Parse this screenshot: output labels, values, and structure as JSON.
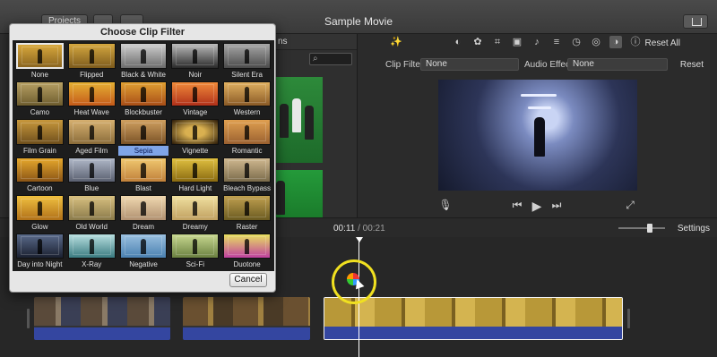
{
  "window": {
    "title": "Sample Movie",
    "projects_button": "Projects"
  },
  "browser": {
    "tab_fragment": "ns",
    "search_placeholder": ""
  },
  "viewer": {
    "reset_all": "Reset All",
    "clip_filter_label": "Clip Filter:",
    "clip_filter_value": "None",
    "audio_effect_label": "Audio Effect:",
    "audio_effect_value": "None",
    "reset": "Reset",
    "tool_icons": [
      "magic-wand-icon",
      "color-balance-icon",
      "palette-icon",
      "crop-icon",
      "camera-icon",
      "volume-icon",
      "equalizer-icon",
      "speed-icon",
      "stabilization-icon",
      "clip-filter-icon",
      "info-icon"
    ],
    "active_tool": "clip-filter-icon"
  },
  "playback": {
    "current_time": "00:11",
    "separator": "/",
    "total_time": "00:21",
    "settings": "Settings"
  },
  "dialog": {
    "title": "Choose Clip Filter",
    "cancel": "Cancel",
    "selected": "Sepia",
    "filters": [
      {
        "name": "None",
        "style": "f-none"
      },
      {
        "name": "Flipped",
        "style": "f-flipped"
      },
      {
        "name": "Black & White",
        "style": "f-bw"
      },
      {
        "name": "Noir",
        "style": "f-noir"
      },
      {
        "name": "Silent Era",
        "style": "f-silent"
      },
      {
        "name": "Camo",
        "style": "f-camo"
      },
      {
        "name": "Heat Wave",
        "style": "f-heat"
      },
      {
        "name": "Blockbuster",
        "style": "f-block"
      },
      {
        "name": "Vintage",
        "style": "f-vintage"
      },
      {
        "name": "Western",
        "style": "f-western"
      },
      {
        "name": "Film Grain",
        "style": "f-grain"
      },
      {
        "name": "Aged Film",
        "style": "f-aged"
      },
      {
        "name": "Sepia",
        "style": "f-sepia"
      },
      {
        "name": "Vignette",
        "style": "f-vignette"
      },
      {
        "name": "Romantic",
        "style": "f-romantic"
      },
      {
        "name": "Cartoon",
        "style": "f-cartoon"
      },
      {
        "name": "Blue",
        "style": "f-blue"
      },
      {
        "name": "Blast",
        "style": "f-blast"
      },
      {
        "name": "Hard Light",
        "style": "f-hard"
      },
      {
        "name": "Bleach Bypass",
        "style": "f-bleach"
      },
      {
        "name": "Glow",
        "style": "f-glow"
      },
      {
        "name": "Old World",
        "style": "f-old"
      },
      {
        "name": "Dream",
        "style": "f-dream"
      },
      {
        "name": "Dreamy",
        "style": "f-dreamy"
      },
      {
        "name": "Raster",
        "style": "f-raster"
      },
      {
        "name": "Day into Night",
        "style": "f-day"
      },
      {
        "name": "X-Ray",
        "style": "f-xray"
      },
      {
        "name": "Negative",
        "style": "f-neg"
      },
      {
        "name": "Sci-Fi",
        "style": "f-scifi"
      },
      {
        "name": "Duotone",
        "style": "f-duo"
      }
    ]
  },
  "colors": {
    "selection_blue": "#7fa5e8",
    "audio_track": "#3446a0",
    "cursor_highlight": "#f0e020"
  }
}
